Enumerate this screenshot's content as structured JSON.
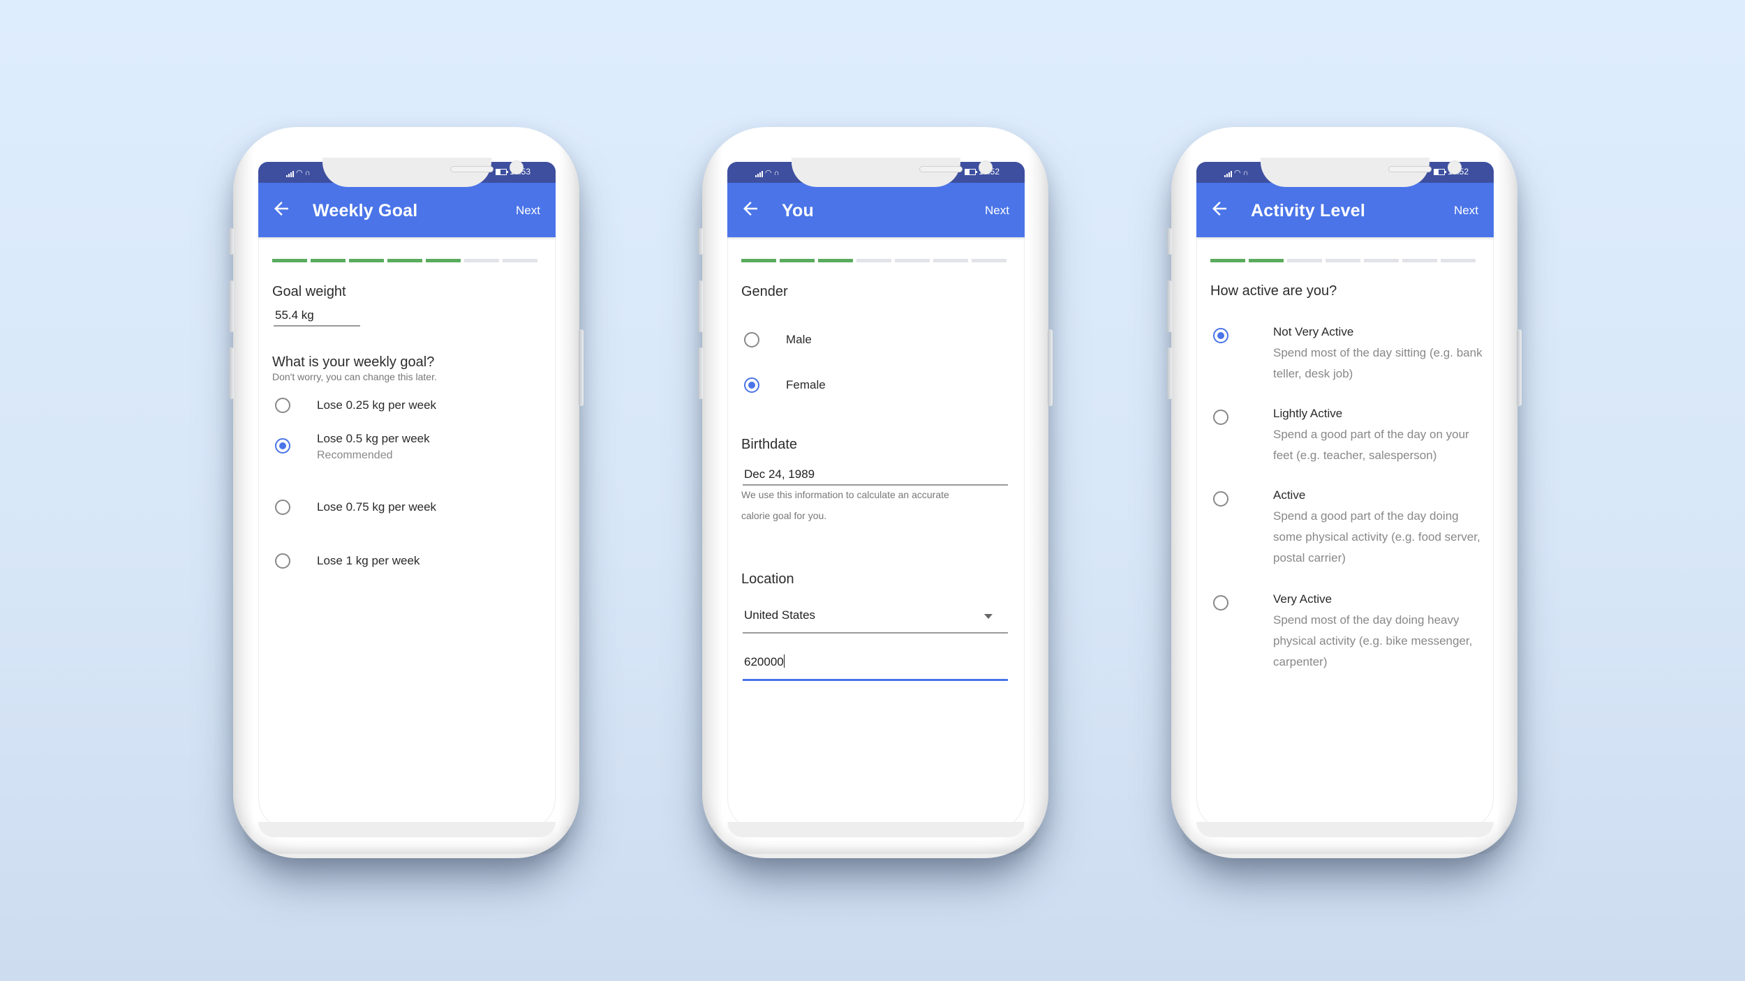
{
  "background_color": "#deedfd",
  "accent_color": "#4a74e8",
  "status_bar_color": "#3e4f9f",
  "progress_done_color": "#5aab5e",
  "progress_todo_color": "#e1e3e8",
  "phones": [
    {
      "status_time": "10:53",
      "title": "Weekly Goal",
      "back_icon": "arrow-left-icon",
      "next_label": "Next",
      "progress": {
        "completed_steps": 5,
        "total_steps": 7
      },
      "goal_weight": {
        "label": "Goal weight",
        "value": "55.4 kg"
      },
      "weekly_goal": {
        "question": "What is your weekly goal?",
        "hint": "Don't worry, you can change this later.",
        "options": [
          {
            "label": "Lose 0.25 kg per week",
            "selected": false
          },
          {
            "label": "Lose 0.5 kg per week",
            "sublabel": "Recommended",
            "selected": true
          },
          {
            "label": "Lose 0.75 kg per week",
            "selected": false
          },
          {
            "label": "Lose 1 kg per week",
            "selected": false
          }
        ]
      }
    },
    {
      "status_time": "10:52",
      "title": "You",
      "back_icon": "arrow-left-icon",
      "next_label": "Next",
      "progress": {
        "completed_steps": 3,
        "total_steps": 7
      },
      "gender": {
        "label": "Gender",
        "options": [
          {
            "label": "Male",
            "selected": false
          },
          {
            "label": "Female",
            "selected": true
          }
        ]
      },
      "birthdate": {
        "label": "Birthdate",
        "value": "Dec 24, 1989",
        "hint_line1": "We use this information to calculate an accurate",
        "hint_line2": "calorie goal for you."
      },
      "location": {
        "label": "Location",
        "country": "United States",
        "postal_code": "620000"
      }
    },
    {
      "status_time": "10:52",
      "title": "Activity Level",
      "back_icon": "arrow-left-icon",
      "next_label": "Next",
      "progress": {
        "completed_steps": 2,
        "total_steps": 7
      },
      "question": "How active are you?",
      "options": [
        {
          "label": "Not Very Active",
          "description": "Spend most of the day sitting (e.g. bank teller, desk job)",
          "selected": true
        },
        {
          "label": "Lightly Active",
          "description": "Spend a good part of the day on your feet (e.g. teacher, salesperson)",
          "selected": false
        },
        {
          "label": "Active",
          "description": "Spend a good part of the day doing some physical activity (e.g. food server, postal carrier)",
          "selected": false
        },
        {
          "label": "Very Active",
          "description": "Spend most of the day doing heavy physical activity (e.g. bike messenger, carpenter)",
          "selected": false
        }
      ]
    }
  ]
}
